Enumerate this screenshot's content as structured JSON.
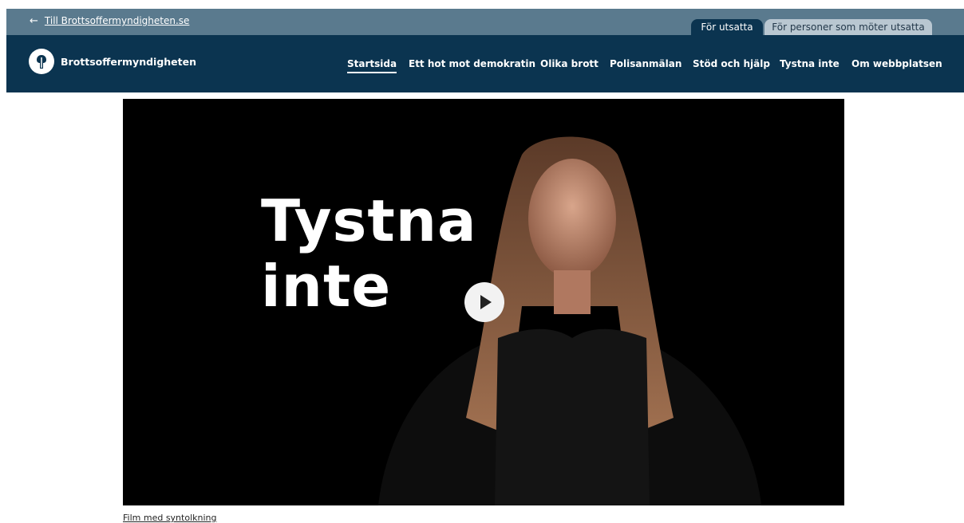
{
  "topbar": {
    "back_link": "Till Brottsoffermyndigheten.se"
  },
  "audience_tabs": [
    {
      "label": "För utsatta",
      "active": true
    },
    {
      "label": "För personer som möter utsatta",
      "active": false
    }
  ],
  "brand": {
    "name": "Brottsoffermyndigheten"
  },
  "nav": {
    "items": [
      {
        "label": "Startsida",
        "active": true
      },
      {
        "label": "Ett hot mot demokratin"
      },
      {
        "label": "Olika brott"
      },
      {
        "label": "Polisanmälan"
      },
      {
        "label": "Stöd och hjälp"
      },
      {
        "label": "Tystna inte"
      },
      {
        "label": "Om webbplatsen"
      }
    ]
  },
  "video": {
    "title_line1": "Tystna",
    "title_line2": "inte",
    "play_icon": "play-icon"
  },
  "caption_link": "Film med syntolkning",
  "colors": {
    "nav_bg": "#0b3450",
    "topbar_bg": "#5a7a8e",
    "inactive_tab_bg": "#b9c7d1"
  }
}
